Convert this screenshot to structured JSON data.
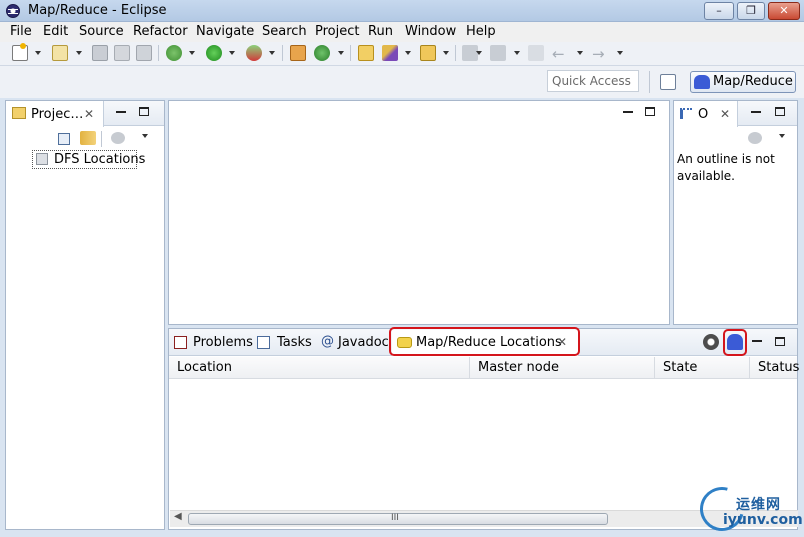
{
  "window": {
    "title": "Map/Reduce - Eclipse",
    "controls": {
      "minimize": "–",
      "restore": "❐",
      "close": "✕"
    }
  },
  "menu": [
    "File",
    "Edit",
    "Source",
    "Refactor",
    "Navigate",
    "Search",
    "Project",
    "Run",
    "Window",
    "Help"
  ],
  "toolbar": {
    "quick_access_placeholder": "Quick Access",
    "perspective": "Map/Reduce"
  },
  "project_explorer": {
    "tab_label": "Projec…",
    "tree": [
      {
        "label": "DFS Locations"
      }
    ]
  },
  "outline": {
    "tab_label": "O",
    "message": "An outline is not available."
  },
  "bottom_panel": {
    "tabs": [
      {
        "label": "Problems"
      },
      {
        "label": "Tasks"
      },
      {
        "label": "Javadoc"
      },
      {
        "label": "Map/Reduce Locations"
      }
    ],
    "columns": [
      "Location",
      "Master node",
      "State",
      "Status"
    ],
    "scroll_grip": "III"
  },
  "colors": {
    "highlight": "#d4151c",
    "background": "#d9e4f1",
    "elephant": "#3b5bd6"
  },
  "watermark": {
    "cn": "运维网",
    "url": "iyunv.com"
  }
}
